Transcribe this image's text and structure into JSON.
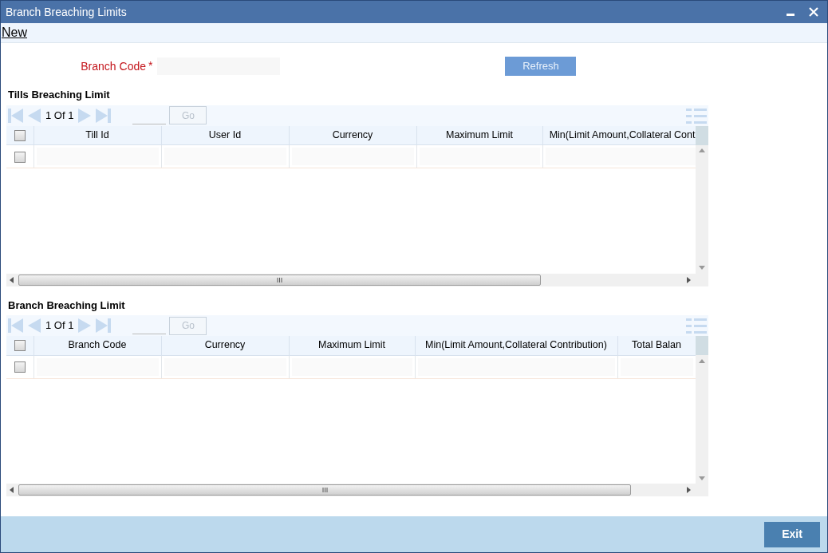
{
  "window": {
    "title": "Branch Breaching Limits",
    "controls": [
      {
        "kind": "minimize"
      },
      {
        "kind": "close"
      }
    ]
  },
  "toolbar": [
    {
      "label": "New"
    }
  ],
  "form": {
    "branch_code": {
      "label": "Branch Code",
      "required_mark": "*"
    },
    "refresh_button": {
      "label": "Refresh",
      "disabled": false
    }
  },
  "grids": [
    {
      "title": "Tills Breaching Limit",
      "pager": "1 Of 1",
      "go_button": {
        "label": "Go",
        "disabled": true
      },
      "select_all_checked": false,
      "columns": [
        "Till Id",
        "User Id",
        "Currency",
        "Maximum Limit",
        "Min(Limit Amount,Collateral Cont"
      ],
      "rows": [
        {
          "checked": false
        }
      ]
    },
    {
      "title": "Branch Breaching Limit",
      "pager": "1 Of 1",
      "go_button": {
        "label": "Go",
        "disabled": true
      },
      "select_all_checked": false,
      "columns": [
        "Branch Code",
        "Currency",
        "Maximum Limit",
        "Min(Limit Amount,Collateral Contribution)",
        "Total Balan"
      ],
      "rows": [
        {
          "checked": false
        }
      ]
    }
  ],
  "footer": {
    "exit_button": {
      "label": "Exit"
    }
  }
}
